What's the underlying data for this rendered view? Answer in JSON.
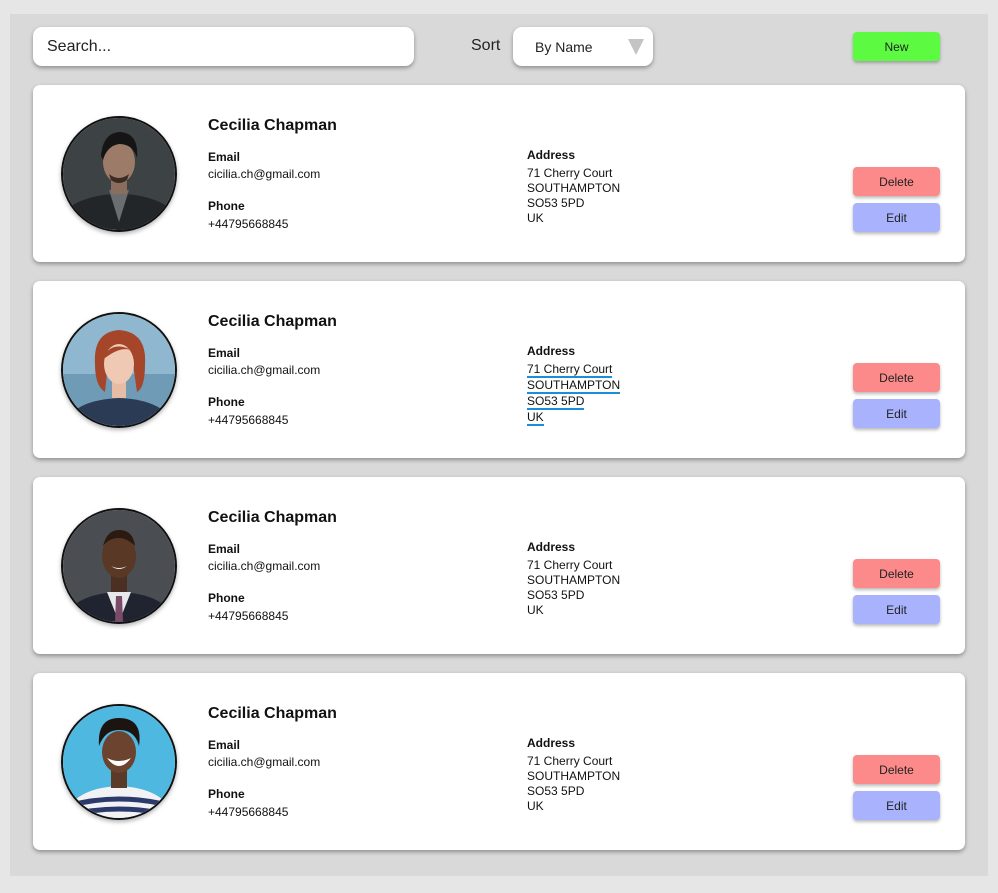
{
  "toolbar": {
    "search_placeholder": "Search...",
    "sort_label": "Sort",
    "sort_value": "By Name",
    "new_label": "New"
  },
  "labels": {
    "email": "Email",
    "phone": "Phone",
    "address": "Address",
    "delete": "Delete",
    "edit": "Edit"
  },
  "contacts": [
    {
      "name": "Cecilia Chapman",
      "email": "cicilia.ch@gmail.com",
      "phone": "+44795668845",
      "address": [
        "71 Cherry Court",
        "SOUTHAMPTON",
        "SO53 5PD",
        "UK"
      ]
    },
    {
      "name": "Cecilia Chapman",
      "email": "cicilia.ch@gmail.com",
      "phone": "+44795668845",
      "address": [
        "71 Cherry Court",
        "SOUTHAMPTON",
        "SO53 5PD",
        "UK"
      ]
    },
    {
      "name": "Cecilia Chapman",
      "email": "cicilia.ch@gmail.com",
      "phone": "+44795668845",
      "address": [
        "71 Cherry Court",
        "SOUTHAMPTON",
        "SO53 5PD",
        "UK"
      ]
    },
    {
      "name": "Cecilia Chapman",
      "email": "cicilia.ch@gmail.com",
      "phone": "+44795668845",
      "address": [
        "71 Cherry Court",
        "SOUTHAMPTON",
        "SO53 5PD",
        "UK"
      ]
    }
  ],
  "colors": {
    "new_button": "#5cfb41",
    "delete_button": "#fd8a8a",
    "edit_button": "#a9b3fd",
    "text_selection_underline": "#1b8fd6"
  }
}
